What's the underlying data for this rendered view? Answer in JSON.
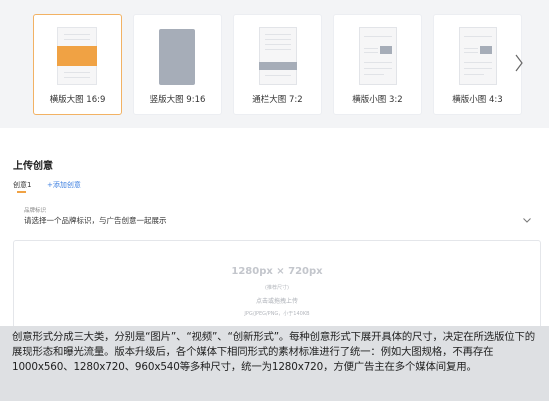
{
  "formats": [
    {
      "label": "横版大图 16:9",
      "selected": true
    },
    {
      "label": "竖版大图 9:16",
      "selected": false
    },
    {
      "label": "通栏大图 7:2",
      "selected": false
    },
    {
      "label": "横版小图 3:2",
      "selected": false
    },
    {
      "label": "横版小图 4:3",
      "selected": false
    }
  ],
  "accent_color": "#f0a244",
  "link_color": "#3c7fe0",
  "next_icon": "chevron-right-icon",
  "upload_section": {
    "title": "上传创意",
    "tabs": {
      "active": "创意1",
      "add": "+添加创意"
    },
    "brand_field": {
      "label": "品牌标识",
      "placeholder": "请选择一个品牌标识，与广告创意一起展示",
      "icon": "chevron-down-icon"
    },
    "dropzone": {
      "size": "1280px × 720px",
      "recommend": "(推荐尺寸)",
      "hint": "点击或拖拽上传",
      "formats": "JPG/JPEG/PNG，小于140KB"
    }
  },
  "caption": "创意形式分成三大类，分别是“图片”、“视频”、“创新形式”。每种创意形式下展开具体的尺寸，决定在所选版位下的展现形态和曝光流量。版本升级后，各个媒体下相同形式的素材标准进行了统一：例如大图规格，不再存在1000x560、1280x720、960x540等多种尺寸，统一为1280x720，方便广告主在多个媒体间复用。"
}
